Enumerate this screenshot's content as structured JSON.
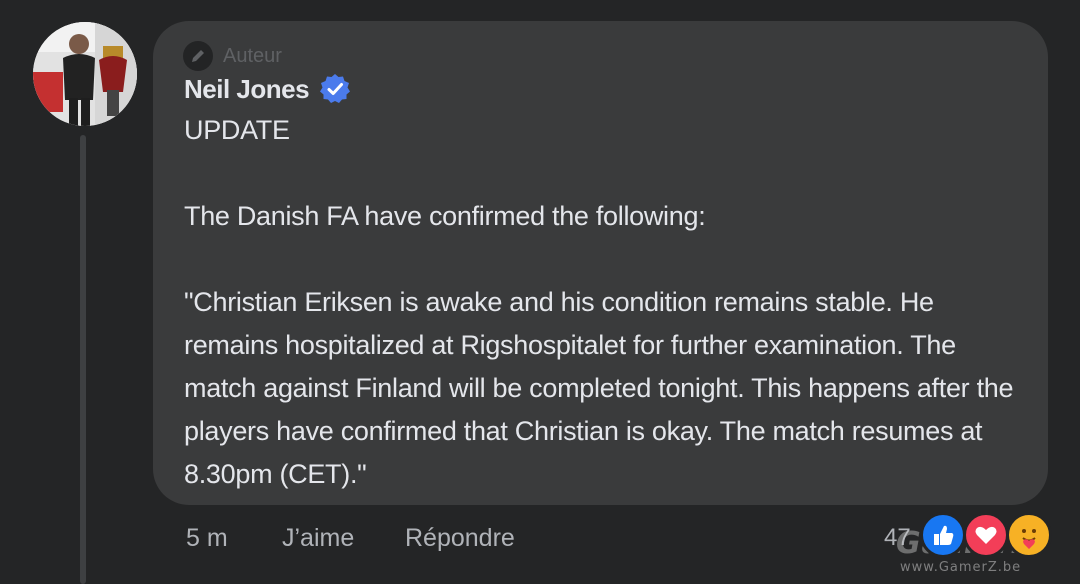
{
  "post": {
    "author_tag": "Auteur",
    "author_name": "Neil Jones",
    "body": "UPDATE\n\nThe Danish FA have confirmed the following:\n\n\"Christian Eriksen is awake and his condition remains stable. He remains hospitalized at Rigshospitalet for further examination. The match against Finland will be completed tonight. This happens after the players have confirmed that Christian is okay. The match resumes at 8.30pm (CET).\""
  },
  "actions": {
    "time": "5 m",
    "like": "J’aime",
    "reply": "Répondre"
  },
  "reactions": {
    "count": "47",
    "types": [
      "like-icon",
      "love-icon",
      "care-icon"
    ],
    "colors": {
      "like": "#1877f2",
      "love": "#f33e58",
      "care": "#f7b125"
    }
  },
  "watermark": {
    "text": "GamerZ",
    "url": "www.GamerZ.be"
  },
  "colors": {
    "background": "#242526",
    "bubble": "#3a3b3c",
    "text": "#e4e6eb",
    "secondary": "#b0b3b8",
    "verified": "#4b7bec"
  }
}
